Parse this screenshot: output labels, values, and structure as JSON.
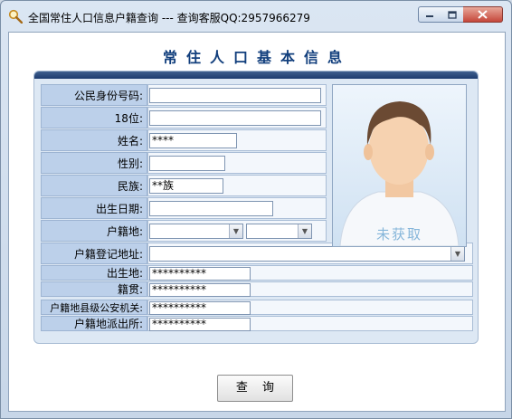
{
  "window": {
    "title": "全国常住人口信息户籍查询 --- 查询客服QQ:2957966279",
    "heading": "常住人口基本信息"
  },
  "form": {
    "id_label": "公民身份号码:",
    "id_value": "",
    "id18_label": "18位:",
    "id18_value": "",
    "name_label": "姓名:",
    "name_value": "****",
    "gender_label": "性别:",
    "gender_value": "",
    "ethnic_label": "民族:",
    "ethnic_value": "**族",
    "birth_label": "出生日期:",
    "birth_value": "",
    "hukou_label": "户籍地:",
    "hukou_province": "",
    "hukou_city": "",
    "hukou_addr_label": "户籍登记地址:",
    "hukou_addr_value": "",
    "birthplace_label": "出生地:",
    "birthplace_value": "**********",
    "native_label": "籍贯:",
    "native_value": "**********",
    "police_label": "户籍地县级公安机关:",
    "police_value": "**********",
    "station_label": "户籍地派出所:",
    "station_value": "**********"
  },
  "photo": {
    "status": "未获取"
  },
  "actions": {
    "query_label": "查 询"
  },
  "icons": {
    "app": "magnifier-icon",
    "minimize": "minimize-icon",
    "maximize": "maximize-icon",
    "close": "close-icon"
  },
  "colors": {
    "heading": "#123f7d",
    "label_bg": "#bcd0ea",
    "panel_bar": "#1d3c6f"
  }
}
